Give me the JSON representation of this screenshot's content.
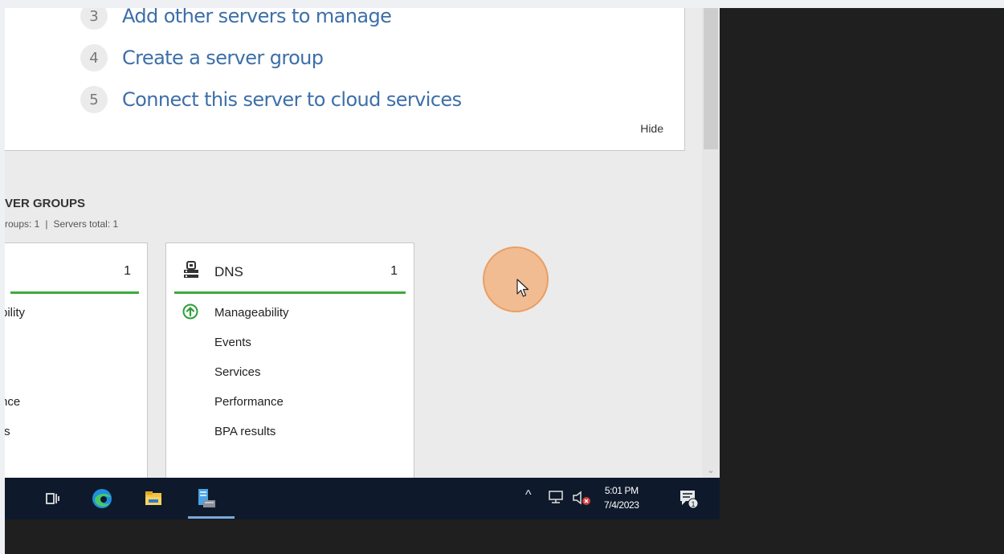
{
  "welcome": {
    "steps": [
      {
        "num": "3",
        "label": "Add other servers to manage"
      },
      {
        "num": "4",
        "label": "Create a server group"
      },
      {
        "num": "5",
        "label": "Connect this server to cloud services"
      }
    ],
    "hide_label": "Hide"
  },
  "server_groups": {
    "title": "VER GROUPS",
    "subtitle_groups": "roups: 1",
    "subtitle_sep": "|",
    "subtitle_servers": "Servers total: 1"
  },
  "tiles": [
    {
      "count": "1",
      "rows": [
        "bility",
        "nce",
        "ts"
      ]
    },
    {
      "name": "DNS",
      "count": "1",
      "rows": [
        "Manageability",
        "Events",
        "Services",
        "Performance",
        "BPA results"
      ],
      "status_color": "#3dab3d"
    }
  ],
  "taskbar": {
    "icons": [
      "task-view-icon",
      "edge-icon",
      "file-explorer-icon",
      "server-manager-icon"
    ],
    "tray": {
      "caret": "^",
      "time": "5:01 PM",
      "date": "7/4/2023",
      "notification_count": "1"
    }
  },
  "colors": {
    "link": "#3d6fa8",
    "status_ok": "#3dab3d",
    "taskbar_bg": "#0e1a2b",
    "cursor_highlight": "#f3b07b"
  }
}
